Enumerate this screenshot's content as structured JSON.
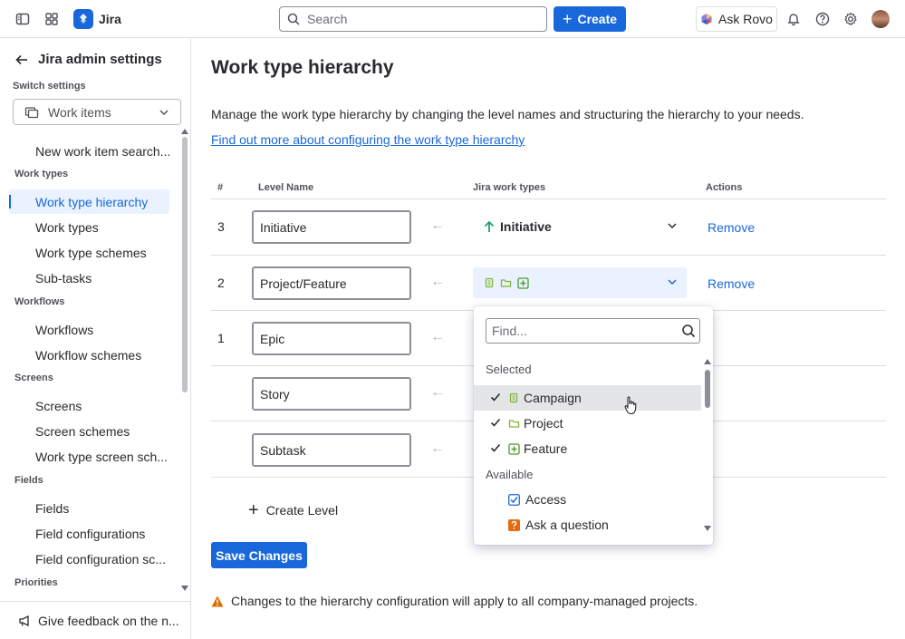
{
  "app": {
    "name": "Jira",
    "brand_color": "#1868db"
  },
  "topbar": {
    "search_placeholder": "Search",
    "create_label": "Create",
    "rovo_label": "Ask Rovo",
    "icons": [
      "sidebar-toggle-icon",
      "app-switcher-icon",
      "bell-icon",
      "help-icon",
      "gear-icon"
    ]
  },
  "sidebar": {
    "back_title": "Jira admin settings",
    "switch_label": "Switch settings",
    "switch_value": "Work items",
    "items": [
      {
        "type": "item",
        "label": "New work item search..."
      },
      {
        "type": "group",
        "label": "Work types"
      },
      {
        "type": "item",
        "label": "Work type hierarchy",
        "active": true
      },
      {
        "type": "item",
        "label": "Work types"
      },
      {
        "type": "item",
        "label": "Work type schemes"
      },
      {
        "type": "item",
        "label": "Sub-tasks"
      },
      {
        "type": "group",
        "label": "Workflows"
      },
      {
        "type": "item",
        "label": "Workflows"
      },
      {
        "type": "item",
        "label": "Workflow schemes"
      },
      {
        "type": "group",
        "label": "Screens"
      },
      {
        "type": "item",
        "label": "Screens"
      },
      {
        "type": "item",
        "label": "Screen schemes"
      },
      {
        "type": "item",
        "label": "Work type screen sch..."
      },
      {
        "type": "group",
        "label": "Fields"
      },
      {
        "type": "item",
        "label": "Fields"
      },
      {
        "type": "item",
        "label": "Field configurations"
      },
      {
        "type": "item",
        "label": "Field configuration sc..."
      },
      {
        "type": "group",
        "label": "Priorities"
      }
    ],
    "feedback_label": "Give feedback on the n..."
  },
  "main": {
    "title": "Work type hierarchy",
    "description": "Manage the work type hierarchy by changing the level names and structuring the hierarchy to your needs.",
    "link": "Find out more about configuring the work type hierarchy",
    "columns": {
      "num": "#",
      "level": "Level Name",
      "types": "Jira work types",
      "actions": "Actions"
    },
    "rows": [
      {
        "num": "3",
        "level": "Initiative",
        "work_type": "Initiative",
        "action": "Remove"
      },
      {
        "num": "2",
        "level": "Project/Feature",
        "work_type": "",
        "action": "Remove"
      },
      {
        "num": "1",
        "level": "Epic",
        "work_type": "",
        "action": ""
      },
      {
        "num": "",
        "level": "Story",
        "work_type": "",
        "action": ""
      },
      {
        "num": "",
        "level": "Subtask",
        "work_type": "",
        "action": ""
      }
    ],
    "create_level": "Create Level",
    "save_label": "Save Changes",
    "warning": "Changes to the hierarchy configuration will apply to all company-managed projects."
  },
  "dropdown": {
    "find_placeholder": "Find...",
    "selected_heading": "Selected",
    "available_heading": "Available",
    "selected": [
      "Campaign",
      "Project",
      "Feature"
    ],
    "available": [
      "Access",
      "Ask a question"
    ]
  }
}
